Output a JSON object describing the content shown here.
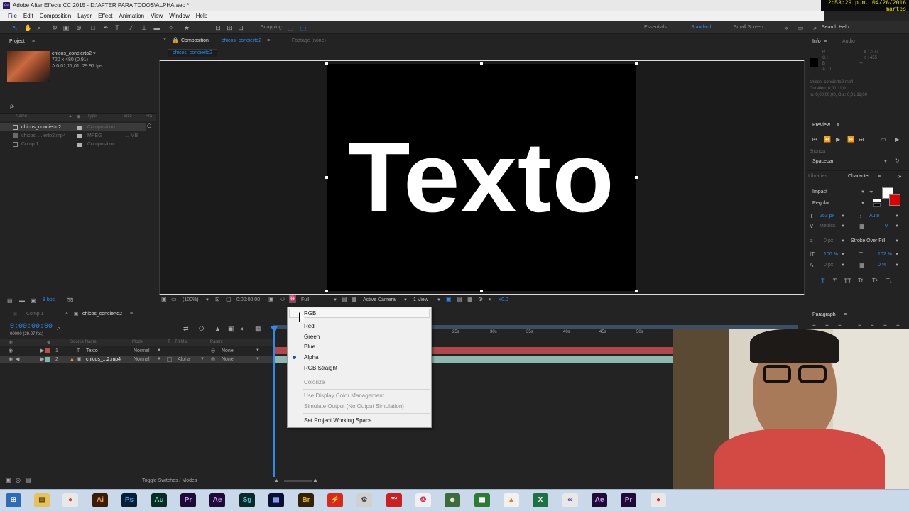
{
  "window": {
    "title": "Adobe After Effects CC 2015 - D:\\AFTER PARA TODOS\\ALPHA.aep *",
    "clock": "2:53:29 p.m. 04/26/2016",
    "clock2": "martes"
  },
  "menubar": [
    "File",
    "Edit",
    "Composition",
    "Layer",
    "Effect",
    "Animation",
    "View",
    "Window",
    "Help"
  ],
  "toolbar": {
    "snapping_label": "Snapping",
    "workspaces": [
      "Essentials",
      "Standard",
      "Small Screen"
    ],
    "search_placeholder": "Search Help"
  },
  "project_panel": {
    "tab": "Project",
    "selected_name": "chicos_concierto2 ▾",
    "selected_info1": "720 x 480 (0.91)",
    "selected_info2": "Δ 0;01;11;01, 29.97 fps",
    "search_placeholder": "ρ̵",
    "columns": [
      "Name",
      "Type",
      "Size",
      "Fra"
    ],
    "items": [
      {
        "name": "chicos_concierto2",
        "type": "Composition",
        "size": "",
        "color": "#b3b3b3"
      },
      {
        "name": "chicos_...ierto2.mp4",
        "type": "MPEG",
        "size": "... MB",
        "color": "#b3b3b3"
      },
      {
        "name": "Comp 1",
        "type": "Composition",
        "size": "",
        "color": "#b3b3b3"
      }
    ],
    "bpc": "8 bpc"
  },
  "comp_panel": {
    "tab_prefix": "Composition",
    "tab_name": "chicos_concierto2",
    "footage_tab": "Footage (none)",
    "sub_tab": "chicos_concierto2",
    "canvas_text": "Texto",
    "zoom": "(100%)",
    "timecode": "0:00:00:00",
    "resolution": "Full",
    "camera": "Active Camera",
    "view": "1 View",
    "exposure": "+0.0"
  },
  "timeline": {
    "tabs": [
      "Comp 1",
      "chicos_concierto2"
    ],
    "current_time": "0:00:00:00",
    "fps_note": "00000 (29.97 fps)",
    "columns": [
      "Source Name",
      "Mode",
      "T",
      "TrkMat",
      "Parent"
    ],
    "layers": [
      {
        "num": "1",
        "name": "Texto",
        "mode": "Normal",
        "trkmat": "",
        "parent": "None",
        "color": "#c14b4b"
      },
      {
        "num": "2",
        "name": "chicos_...2.mp4",
        "mode": "Normal",
        "trkmat": "Alpha",
        "parent": "None",
        "color": "#7fb3ab"
      }
    ],
    "ruler": [
      "25s",
      "30s",
      "35s",
      "40s",
      "45s",
      "50s"
    ],
    "footer": "Toggle Switches / Modes"
  },
  "channel_menu": {
    "items": [
      {
        "label": "RGB",
        "enabled": true,
        "checked": false
      },
      {
        "label": "Red",
        "enabled": true,
        "checked": false
      },
      {
        "label": "Green",
        "enabled": true,
        "checked": false
      },
      {
        "label": "Blue",
        "enabled": true,
        "checked": false
      },
      {
        "label": "Alpha",
        "enabled": true,
        "checked": true
      },
      {
        "label": "RGB Straight",
        "enabled": true,
        "checked": false
      },
      {
        "label": "Colorize",
        "enabled": false,
        "checked": false
      },
      {
        "label": "Use Display Color Management",
        "enabled": false,
        "checked": false
      },
      {
        "label": "Simulate Output (No Output Simulation)",
        "enabled": false,
        "checked": false
      },
      {
        "label": "Set Project Working Space...",
        "enabled": true,
        "checked": false
      }
    ]
  },
  "info_panel": {
    "tabs": [
      "Info",
      "Audio"
    ],
    "r": "R :",
    "g": "G :",
    "b": "B :",
    "a": "A : 0",
    "x": "X : -377",
    "y": "Y : 455",
    "file": "chicos_concierto2.mp4",
    "duration": "Duration: 0;01;11;01",
    "in_out": "In: 0;00;00;00, Out: 0;01;11;00"
  },
  "preview_panel": {
    "title": "Preview",
    "shortcut_label": "Shortcut",
    "shortcut_value": "Spacebar"
  },
  "character_panel": {
    "tabs": [
      "Libraries",
      "Character"
    ],
    "font": "Impact",
    "style": "Regular",
    "size": "253 px",
    "leading": "Auto",
    "kerning": "Metrics",
    "tracking": "0",
    "stroke_width": "0 px",
    "stroke_mode": "Stroke Over Fill",
    "vscale": "100 %",
    "hscale": "102 %",
    "baseline": "0 px",
    "tsume": "0 %"
  },
  "paragraph_panel": {
    "title": "Paragraph"
  },
  "taskbar": [
    {
      "name": "start",
      "label": "⊞",
      "bg": "#2f6cb5",
      "fg": "#ffffff"
    },
    {
      "name": "explorer",
      "label": "▤",
      "bg": "#e5c35a",
      "fg": "#6a4a10"
    },
    {
      "name": "chrome",
      "label": "●",
      "bg": "#e8e8e8",
      "fg": "#d8402b"
    },
    {
      "name": "illustrator",
      "label": "Ai",
      "bg": "#3a1d06",
      "fg": "#f19a36"
    },
    {
      "name": "photoshop",
      "label": "Ps",
      "bg": "#061d33",
      "fg": "#31a8ff"
    },
    {
      "name": "audition",
      "label": "Au",
      "bg": "#0a2a24",
      "fg": "#3fe0c0"
    },
    {
      "name": "premiere",
      "label": "Pr",
      "bg": "#1e0a33",
      "fg": "#c99aff"
    },
    {
      "name": "aftereffects",
      "label": "Ae",
      "bg": "#1e0a33",
      "fg": "#c99aff"
    },
    {
      "name": "speedgrade",
      "label": "Sg",
      "bg": "#0a2a2a",
      "fg": "#3fcfcf"
    },
    {
      "name": "mediaencoder",
      "label": "▩",
      "bg": "#0a1033",
      "fg": "#8fa6ff"
    },
    {
      "name": "bridge",
      "label": "Br",
      "bg": "#332200",
      "fg": "#e8b020"
    },
    {
      "name": "app-flash",
      "label": "⚡",
      "bg": "#d82a1c",
      "fg": "#ffffff"
    },
    {
      "name": "app-gear",
      "label": "⚙",
      "bg": "#d0d0d0",
      "fg": "#333333"
    },
    {
      "name": "app-acrobat",
      "label": "™",
      "bg": "#cc1f1f",
      "fg": "#ffffff"
    },
    {
      "name": "app-davinci",
      "label": "❂",
      "bg": "#f0f0f0",
      "fg": "#d23366"
    },
    {
      "name": "app-map",
      "label": "◆",
      "bg": "#3d6b3d",
      "fg": "#dfe8c0"
    },
    {
      "name": "app-sheet",
      "label": "▦",
      "bg": "#2b7a36",
      "fg": "#ffffff"
    },
    {
      "name": "app-vlc",
      "label": "▲",
      "bg": "#f1f1f1",
      "fg": "#f07a10"
    },
    {
      "name": "excel",
      "label": "X",
      "bg": "#1e7145",
      "fg": "#ffffff"
    },
    {
      "name": "app-vs",
      "label": "∞",
      "bg": "#e8e8e8",
      "fg": "#5c2d91"
    },
    {
      "name": "aftereffects-active",
      "label": "Ae",
      "bg": "#1e0a33",
      "fg": "#c99aff"
    },
    {
      "name": "premiere-2",
      "label": "Pr",
      "bg": "#1e0a33",
      "fg": "#c99aff"
    },
    {
      "name": "record",
      "label": "●",
      "bg": "#e8e8e8",
      "fg": "#d8231c"
    }
  ]
}
